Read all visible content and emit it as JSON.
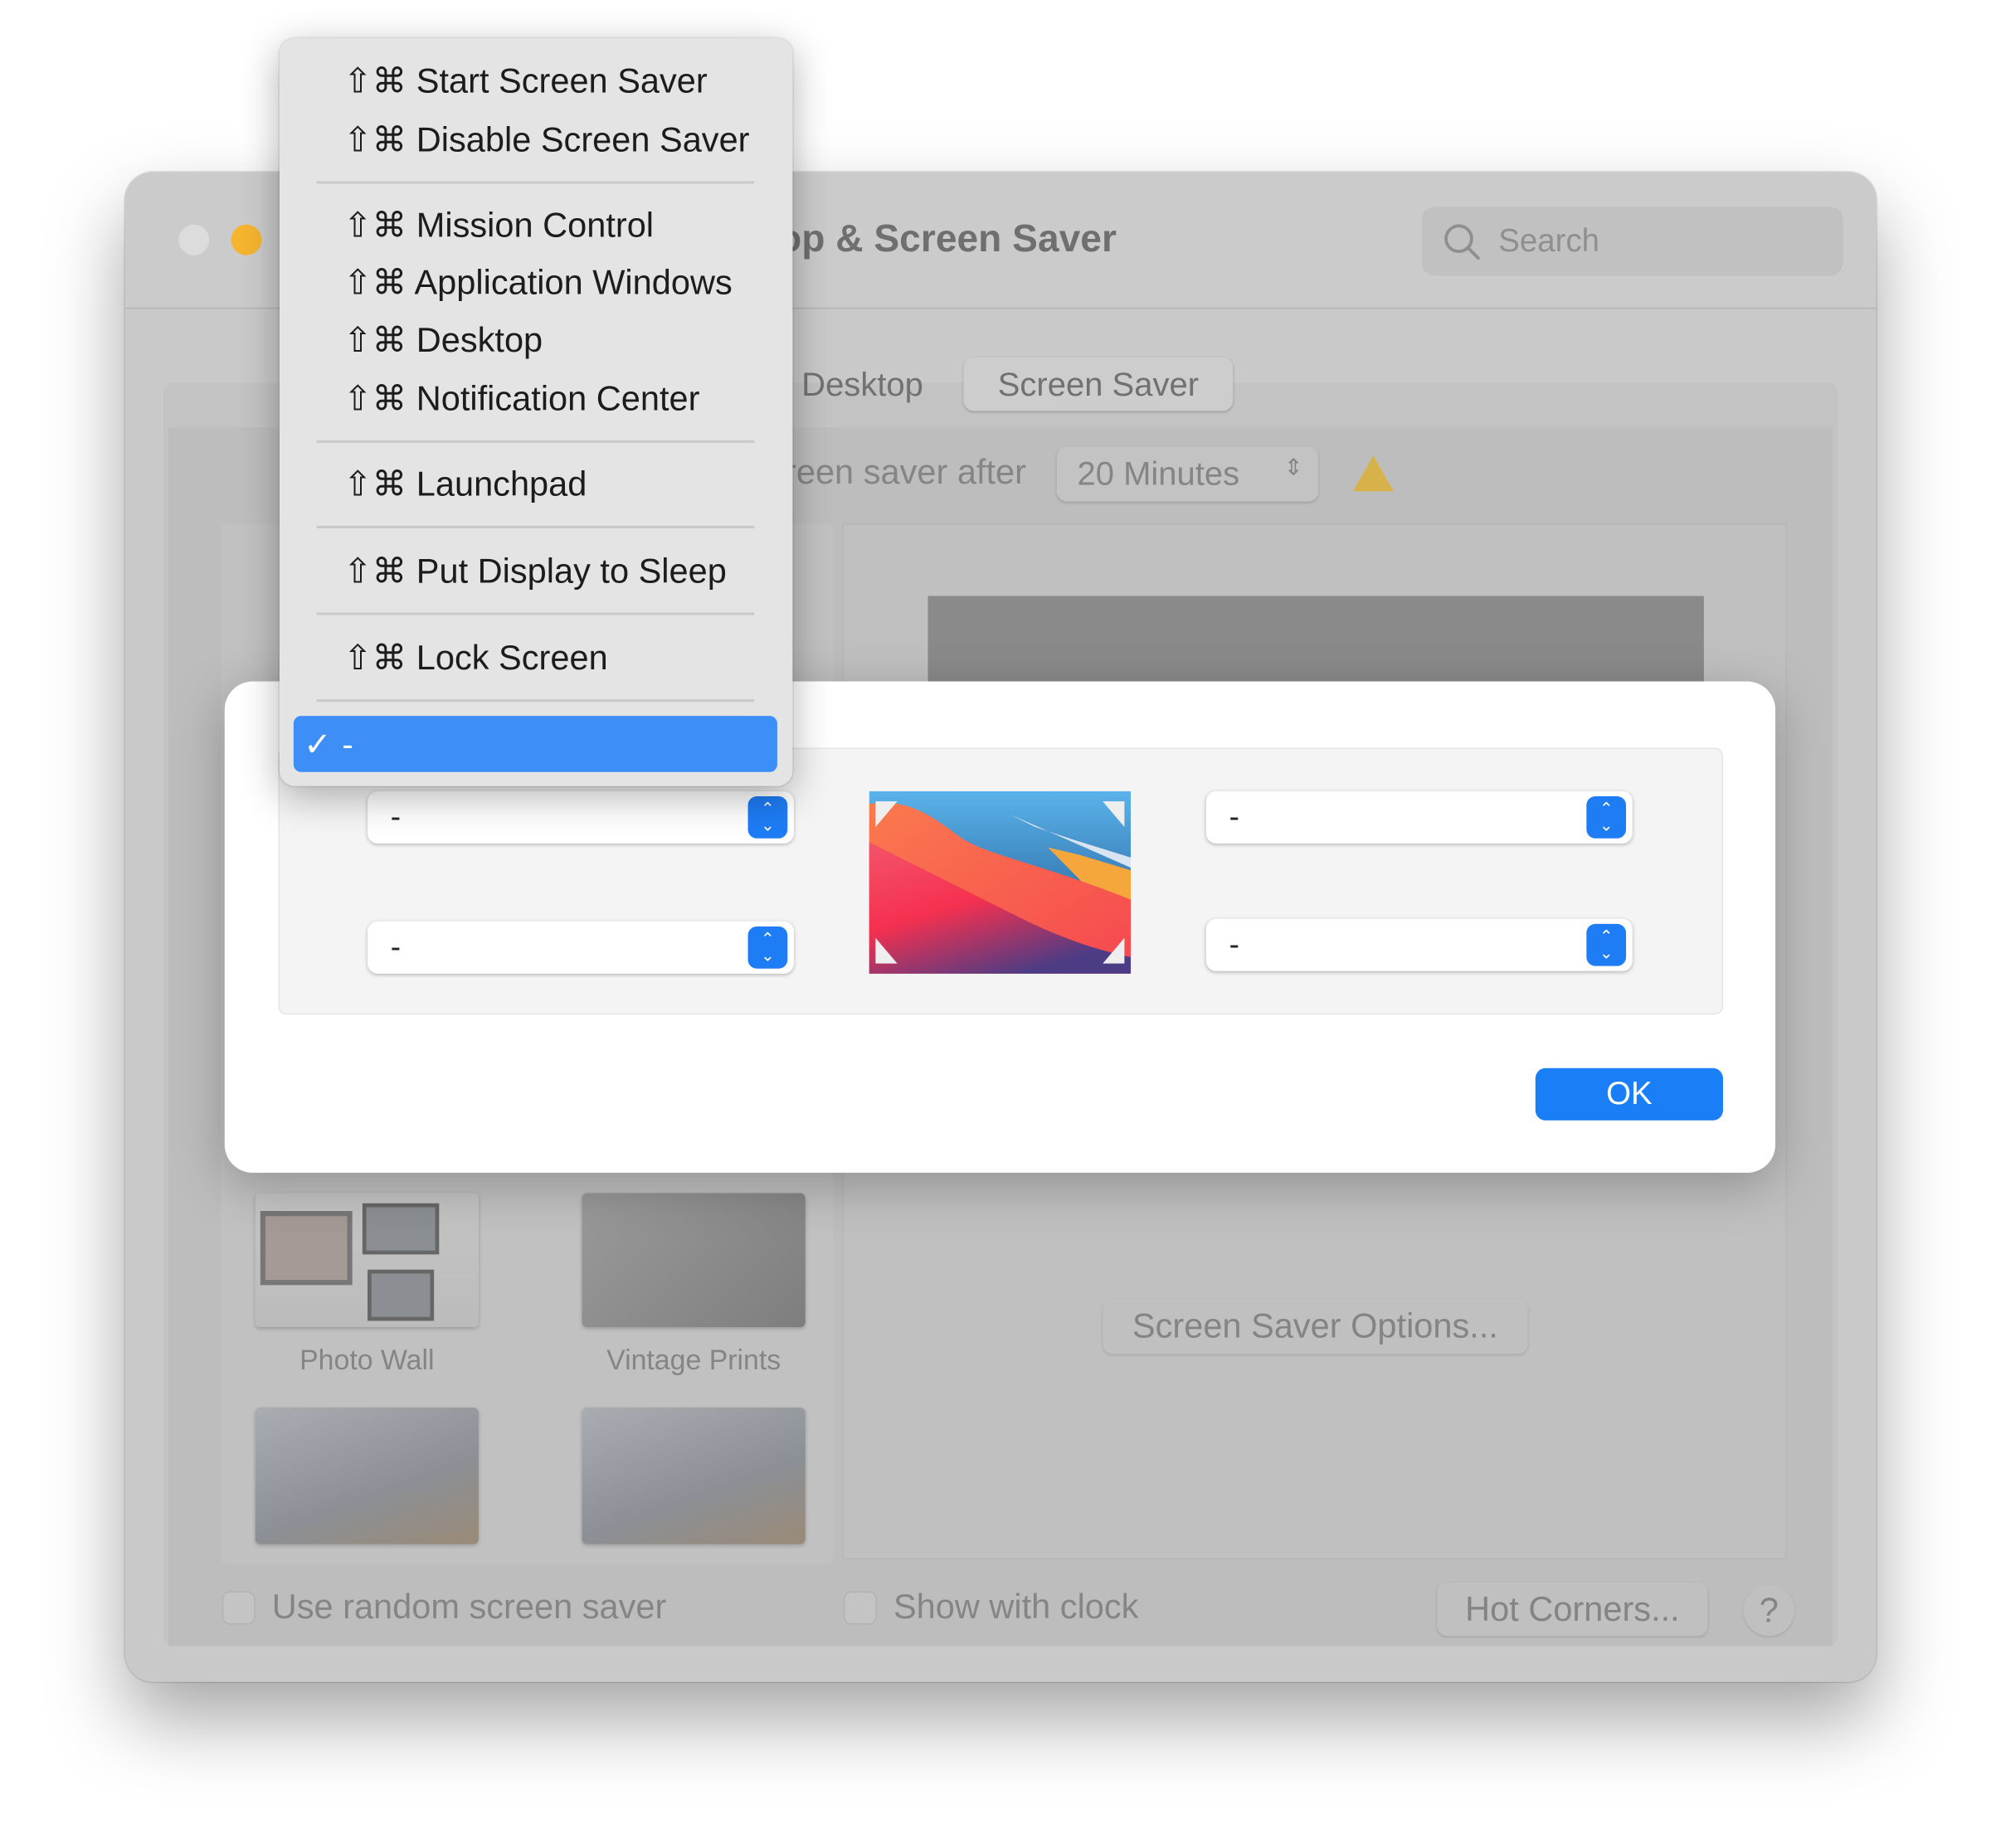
{
  "window": {
    "title": "Desktop & Screen Saver",
    "search_placeholder": "Search",
    "tabs": [
      {
        "label": "Desktop"
      },
      {
        "label": "Screen Saver",
        "selected": true
      }
    ],
    "start_after_label": "Start screen saver after",
    "start_after_value": "20 Minutes",
    "savers": [
      {
        "label": "Photo Wall"
      },
      {
        "label": "Vintage Prints"
      }
    ],
    "options_button": "Screen Saver Options...",
    "random_checkbox": "Use random screen saver",
    "clock_checkbox": "Show with clock",
    "hot_corners_button": "Hot Corners...",
    "help_button": "?"
  },
  "dialog": {
    "corners": {
      "top_left": "-",
      "bottom_left": "-",
      "top_right": "-",
      "bottom_right": "-"
    },
    "ok_button": "OK"
  },
  "menu": {
    "shortcut_prefix": "⇧⌘",
    "items": [
      {
        "label": "Start Screen Saver"
      },
      {
        "label": "Disable Screen Saver"
      },
      {
        "label": "Mission Control"
      },
      {
        "label": "Application Windows"
      },
      {
        "label": "Desktop"
      },
      {
        "label": "Notification Center"
      },
      {
        "label": "Launchpad"
      },
      {
        "label": "Put Display to Sleep"
      },
      {
        "label": "Lock Screen"
      }
    ],
    "selected": {
      "check": "✓",
      "label": "-"
    }
  },
  "colors": {
    "accent": "#1a7ff6",
    "menu_highlight": "#3d8ef7",
    "minimize": "#f5b52f"
  }
}
